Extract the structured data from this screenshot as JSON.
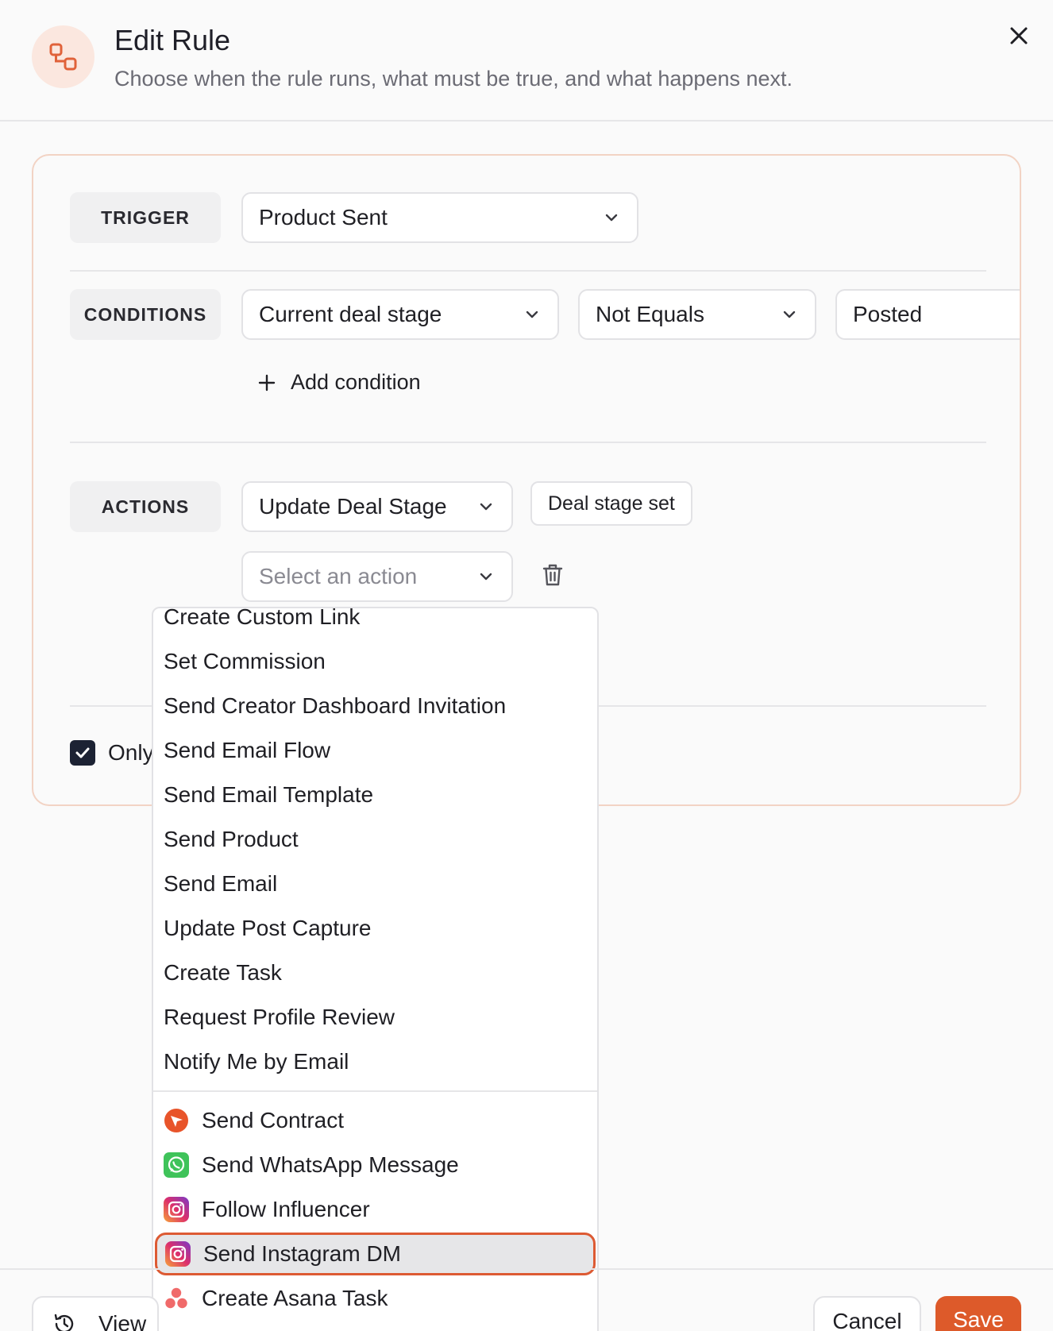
{
  "header": {
    "title": "Edit Rule",
    "subtitle": "Choose when the rule runs, what must be true, and what happens next."
  },
  "trigger": {
    "label": "TRIGGER",
    "value": "Product Sent"
  },
  "conditions": {
    "label": "CONDITIONS",
    "field": "Current deal stage",
    "operator": "Not Equals",
    "value": "Posted",
    "add_label": "Add condition"
  },
  "actions": {
    "label": "ACTIONS",
    "first_action": "Update Deal Stage",
    "first_action_chip": "Deal stage set",
    "second_action_placeholder": "Select an action"
  },
  "only_checkbox": {
    "checked": true,
    "label": "Only"
  },
  "dropdown": {
    "items": [
      "Create Custom Link",
      "Set Commission",
      "Send Creator Dashboard Invitation",
      "Send Email Flow",
      "Send Email Template",
      "Send Product",
      "Send Email",
      "Update Post Capture",
      "Create Task",
      "Request Profile Review",
      "Notify Me by Email"
    ],
    "integrations": [
      {
        "label": "Send Contract",
        "icon": "contract-send-icon",
        "color": "#e8542a"
      },
      {
        "label": "Send WhatsApp Message",
        "icon": "whatsapp-icon",
        "color": "#3fc35a"
      },
      {
        "label": "Follow Influencer",
        "icon": "instagram-icon",
        "color": "#c13584"
      },
      {
        "label": "Send Instagram DM",
        "icon": "instagram-icon",
        "color": "#c13584"
      },
      {
        "label": "Create Asana Task",
        "icon": "asana-icon",
        "color": "#f06a6a"
      }
    ],
    "highlighted": "Send Instagram DM"
  },
  "footer": {
    "view_label": "View",
    "cancel_label": "Cancel",
    "save_label": "Save"
  },
  "colors": {
    "accent": "#dd5a2a",
    "card_border": "#f2d3c4",
    "header_icon_bg": "#fbe7df",
    "checkbox": "#1c2233"
  }
}
